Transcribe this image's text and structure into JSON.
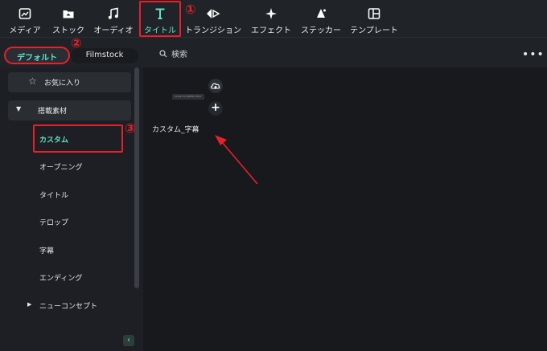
{
  "toolbar": {
    "tabs": [
      {
        "label": "メディア",
        "icon": "media-icon"
      },
      {
        "label": "ストック",
        "icon": "stock-icon"
      },
      {
        "label": "オーディオ",
        "icon": "audio-icon"
      },
      {
        "label": "タイトル",
        "icon": "title-icon"
      },
      {
        "label": "トランジション",
        "icon": "transition-icon"
      },
      {
        "label": "エフェクト",
        "icon": "effect-icon"
      },
      {
        "label": "ステッカー",
        "icon": "sticker-icon"
      },
      {
        "label": "テンプレート",
        "icon": "template-icon"
      }
    ],
    "active_tab": "タイトル"
  },
  "annotations": {
    "n1": "①",
    "n2": "②",
    "n3": "③",
    "color": "#e8202a"
  },
  "subbar": {
    "default_tab": "デフォルト",
    "filmstock_tab": "Filmstock",
    "search_placeholder": "検索",
    "more": "•••"
  },
  "sidebar": {
    "favorites": "お気に入り",
    "category": "搭載素材",
    "items": [
      "カスタム",
      "オープニング",
      "タイトル",
      "テロップ",
      "字幕",
      "エンディング",
      "ニューコンセプト"
    ],
    "active_item": "カスタム",
    "collapse": "‹"
  },
  "content": {
    "card_label": "カスタム_字幕",
    "thumb_text": "CLICK TO  ENTER TEXT",
    "add": "+"
  },
  "colors": {
    "accent": "#5fe3c9",
    "background": "#17191d",
    "sidebar": "#1d1f24"
  }
}
